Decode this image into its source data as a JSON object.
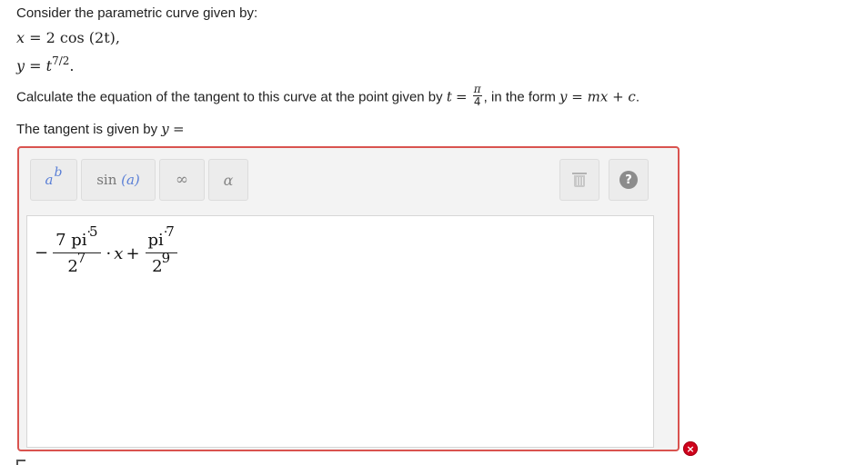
{
  "question": {
    "intro": "Consider the parametric curve given by:",
    "x_lhs": "x",
    "x_eq": "=",
    "x_rhs": "2 cos (2t),",
    "y_lhs": "y",
    "y_eq": "=",
    "y_base": "t",
    "y_exp": "7/2",
    "y_end": ".",
    "task_before": "Calculate the equation of the tangent to this curve at the point given by",
    "task_t": "t",
    "task_eq": "=",
    "task_frac_num": "π",
    "task_frac_den": "4",
    "task_after": ", in the form",
    "task_form": "y = mx + c",
    "task_end": ".",
    "answer_prompt": "The tangent is given by",
    "answer_y": "y",
    "answer_eq": "="
  },
  "toolbar": {
    "power_base": "a",
    "power_exp": "b",
    "sin_fn": "sin",
    "sin_arg": "(a)",
    "infinity": "∞",
    "alpha": "α",
    "trash_icon": "trash-icon",
    "help_icon": "help-icon",
    "help_glyph": "?"
  },
  "answer": {
    "neg": "−",
    "t1_num_coef": "7 pi",
    "t1_num_dot": "·",
    "t1_num_exp": "5",
    "t1_den_base": "2",
    "t1_den_exp": "7",
    "times": "·",
    "x": "x",
    "plus": "+",
    "t2_num_base": "pi",
    "t2_num_dot": "·",
    "t2_num_exp": "7",
    "t2_den_base": "2",
    "t2_den_exp": "9"
  },
  "status": {
    "error_icon": "error-x-icon",
    "error_glyph": "×",
    "border_color": "#d9534f",
    "error_color": "#d0021b"
  }
}
